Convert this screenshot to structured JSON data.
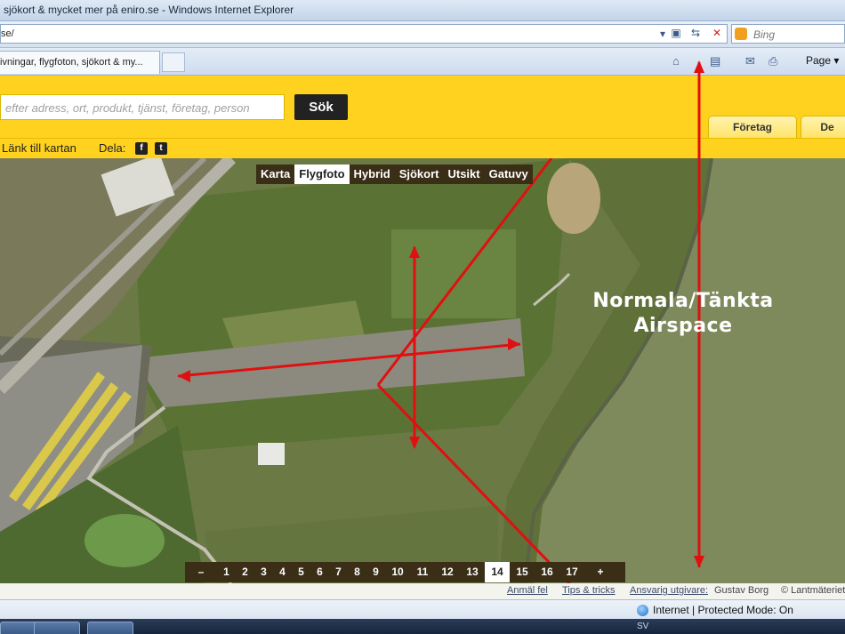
{
  "window": {
    "title": "sjökort & mycket mer på eniro.se - Windows Internet Explorer"
  },
  "addressbar": {
    "url": "se/",
    "search_placeholder": "Bing"
  },
  "tab": {
    "label": "ivningar, flygfoton, sjökort & my..."
  },
  "commandbar": {
    "page_label": "Page ▾"
  },
  "eniro": {
    "search_placeholder": "efter adress, ort, produkt, tjänst, företag, person",
    "search_button": "Sök",
    "top_tabs": [
      "Företag",
      "De"
    ],
    "link_label": "Länk till kartan",
    "share_label": "Dela:",
    "facebook_glyph": "f",
    "twitter_glyph": "t"
  },
  "map": {
    "types": [
      {
        "label": "Karta",
        "active": false
      },
      {
        "label": "Flygfoto",
        "active": true
      },
      {
        "label": "Hybrid",
        "active": false
      },
      {
        "label": "Sjökort",
        "active": false
      },
      {
        "label": "Utsikt",
        "active": false
      },
      {
        "label": "Gatuvy",
        "active": false
      }
    ],
    "annotation_line1": "Normala/Tänkta",
    "annotation_line2": "Airspace",
    "zoom_levels": [
      "–",
      "1",
      "2",
      "3",
      "4",
      "5",
      "6",
      "7",
      "8",
      "9",
      "10",
      "11",
      "12",
      "13",
      "14",
      "15",
      "16",
      "17",
      "+"
    ],
    "active_zoom": "14",
    "annotation_color": "#e01010"
  },
  "credits": {
    "report": "Anmäl fel",
    "tips": "Tips & tricks",
    "publisher_label": "Ansvarig utgivare:",
    "publisher_name": "Gustav Borg",
    "copyright": "© Lantmäteriet"
  },
  "statusbar": {
    "zone": "Internet | Protected Mode: On"
  },
  "taskbar": {
    "tray": "SV"
  }
}
